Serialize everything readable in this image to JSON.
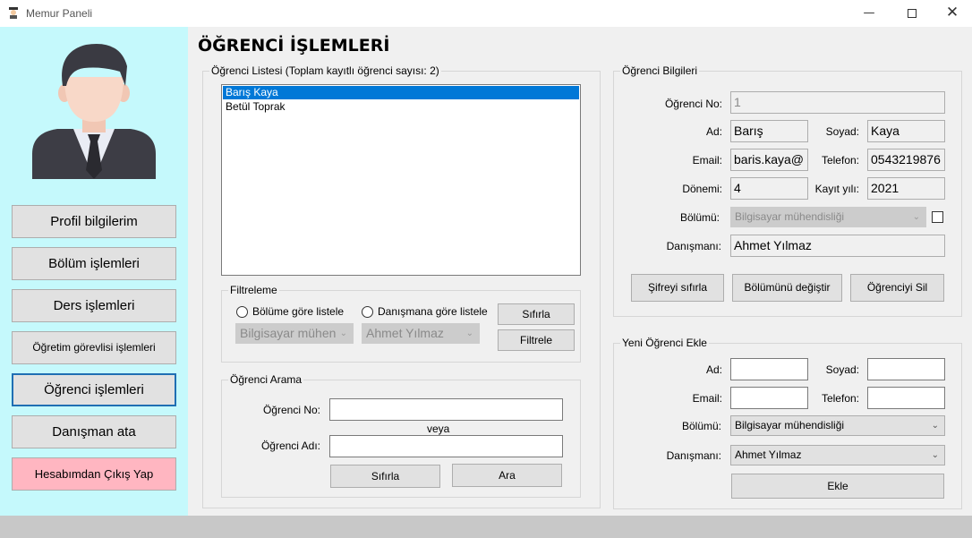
{
  "window": {
    "title": "Memur Paneli"
  },
  "sidebar": {
    "buttons": [
      "Profil bilgilerim",
      "Bölüm işlemleri",
      "Ders işlemleri",
      "Öğretim görevlisi işlemleri",
      "Öğrenci işlemleri",
      "Danışman ata",
      "Hesabımdan Çıkış Yap"
    ],
    "active": "Öğrenci işlemleri"
  },
  "page_title": "ÖĞRENCİ İŞLEMLERİ",
  "student_list": {
    "legend": "Öğrenci Listesi (Toplam kayıtlı öğrenci sayısı: 2)",
    "items": [
      "Barış Kaya",
      "Betül Toprak"
    ],
    "selected": "Barış Kaya"
  },
  "filter": {
    "legend": "Filtreleme",
    "radio_department": "Bölüme göre listele",
    "radio_advisor": "Danışmana göre listele",
    "department_value": "Bilgisayar mühen",
    "advisor_value": "Ahmet Yılmaz",
    "reset_label": "Sıfırla",
    "filter_label": "Filtrele"
  },
  "search": {
    "legend": "Öğrenci Arama",
    "no_label": "Öğrenci No:",
    "or_label": "veya",
    "name_label": "Öğrenci Adı:",
    "no_value": "",
    "name_value": "",
    "reset_label": "Sıfırla",
    "search_label": "Ara"
  },
  "info": {
    "legend": "Öğrenci Bilgileri",
    "no_label": "Öğrenci No:",
    "no_value": "1",
    "name_label": "Ad:",
    "name_value": "Barış",
    "surname_label": "Soyad:",
    "surname_value": "Kaya",
    "email_label": "Email:",
    "email_value": "baris.kaya@",
    "phone_label": "Telefon:",
    "phone_value": "0543219876",
    "term_label": "Dönemi:",
    "term_value": "4",
    "year_label": "Kayıt yılı:",
    "year_value": "2021",
    "department_label": "Bölümü:",
    "department_value": "Bilgisayar mühendisliği",
    "advisor_label": "Danışmanı:",
    "advisor_value": "Ahmet Yılmaz",
    "reset_password_label": "Şifreyi sıfırla",
    "change_department_label": "Bölümünü değiştir",
    "delete_label": "Öğrenciyi Sil"
  },
  "new_student": {
    "legend": "Yeni Öğrenci Ekle",
    "name_label": "Ad:",
    "surname_label": "Soyad:",
    "email_label": "Email:",
    "phone_label": "Telefon:",
    "department_label": "Bölümü:",
    "department_value": "Bilgisayar mühendisliği",
    "advisor_label": "Danışmanı:",
    "advisor_value": "Ahmet Yılmaz",
    "add_label": "Ekle"
  },
  "colors": {
    "sidebar_bg": "#c5f9fc",
    "selection": "#0078d7",
    "logout_bg": "#ffb6c1",
    "active_border": "#1f6fb3"
  },
  "icons": [
    "app-icon",
    "avatar-icon",
    "minimize-icon",
    "maximize-icon",
    "close-icon",
    "chevron-down-icon"
  ]
}
